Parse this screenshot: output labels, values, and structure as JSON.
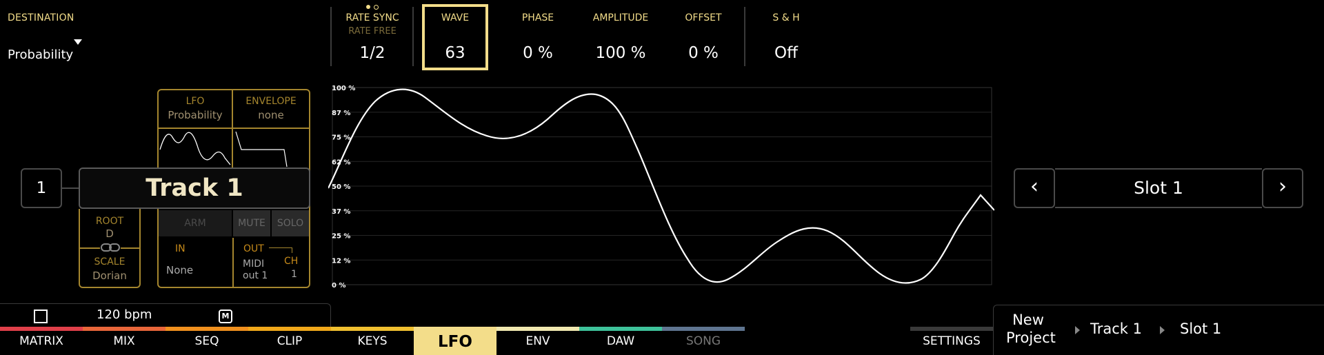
{
  "destination": {
    "label": "DESTINATION",
    "value": "Probability"
  },
  "params": {
    "rate_sync": "RATE SYNC",
    "rate_free": "RATE FREE",
    "rate_value": "1/2",
    "wave_label": "WAVE",
    "wave_value": "63",
    "phase_label": "PHASE",
    "phase_value": "0 %",
    "amplitude_label": "AMPLITUDE",
    "amplitude_value": "100 %",
    "offset_label": "OFFSET",
    "offset_value": "0 %",
    "sh_label": "S & H",
    "sh_value": "Off"
  },
  "modulator": {
    "lfo_label": "LFO",
    "lfo_target": "Probability",
    "env_label": "ENVELOPE",
    "env_target": "none"
  },
  "track": {
    "number": "1",
    "name": "Track 1",
    "root_label": "ROOT",
    "root_value": "D",
    "scale_label": "SCALE",
    "scale_value": "Dorian",
    "arm": "ARM",
    "mute": "MUTE",
    "solo": "SOLO",
    "in_label": "IN",
    "in_value": "None",
    "out_label": "OUT",
    "out_value_1": "MIDI",
    "out_value_2": "out 1",
    "ch_label": "CH",
    "ch_value": "1"
  },
  "graph": {
    "y_ticks": [
      "100 %",
      "87 %",
      "75 %",
      "62 %",
      "50 %",
      "37 %",
      "25 %",
      "12 %",
      "0 %"
    ]
  },
  "slot": {
    "prev": "‹",
    "label": "Slot 1",
    "next": "›"
  },
  "transport": {
    "bpm": "120 bpm",
    "metronome": "M"
  },
  "tabs": [
    "MATRIX",
    "MIX",
    "SEQ",
    "CLIP",
    "KEYS",
    "LFO",
    "ENV",
    "DAW",
    "SONG"
  ],
  "active_tab": "LFO",
  "settings": "SETTINGS",
  "breadcrumb": {
    "project_1": "New",
    "project_2": "Project",
    "track": "Track 1",
    "slot": "Slot 1"
  },
  "colors": {
    "accent": "#f3dd8a",
    "tab_colors": [
      "#e0404a",
      "#e8663a",
      "#f0901e",
      "#f0a81a",
      "#f0c030",
      "#f3dd8a",
      "#f0e8b0",
      "#3ec29a",
      "#5f7590"
    ]
  }
}
